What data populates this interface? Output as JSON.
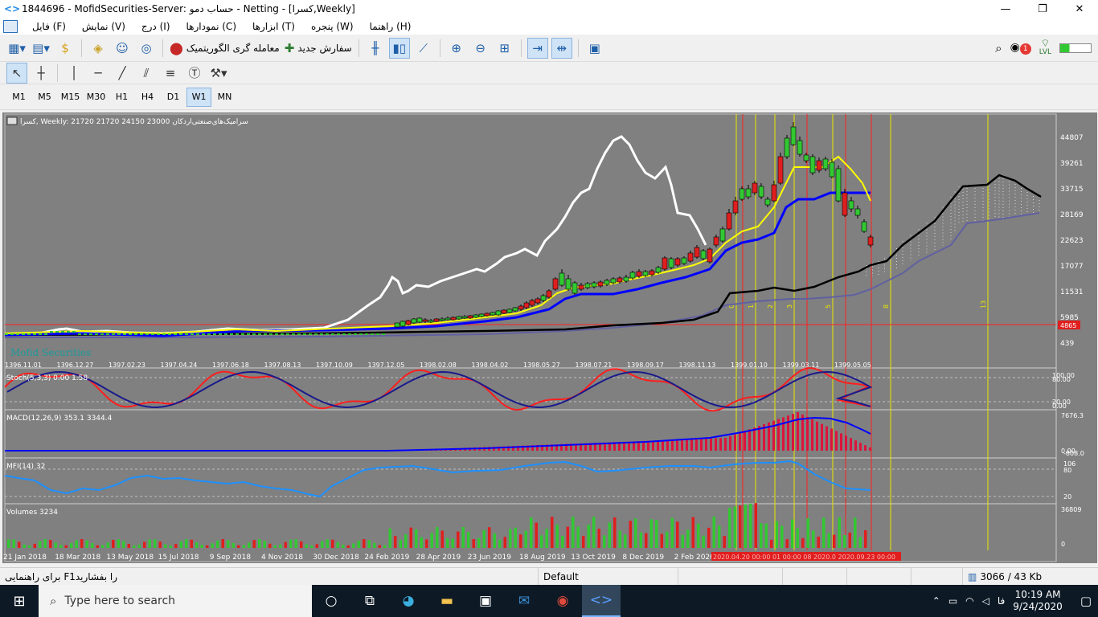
{
  "window": {
    "title": "1844696 - MofidSecurities-Server: حساب دمو - Netting - [کسرا,Weekly]",
    "minimize": "—",
    "maximize": "❐",
    "close": "✕"
  },
  "menu": [
    "فایل (F)",
    "نمایش (V)",
    "درج (I)",
    "نمودارها (C)",
    "ابزارها (T)",
    "پنجره (W)",
    "راهنما (H)"
  ],
  "toolbar": {
    "algo_trading": "معامله گری الگوریتمیک",
    "new_order": "سفارش جدید",
    "notification_count": "1",
    "level_label": "LVL"
  },
  "timeframes": [
    "M1",
    "M5",
    "M15",
    "M30",
    "H1",
    "H4",
    "D1",
    "W1",
    "MN"
  ],
  "active_timeframe": "W1",
  "chart": {
    "header": "کسرا, Weekly:  21720 21720 24150 23000  سرامیک‌های‌صنعتی‌اردکان",
    "watermark": "Mofid Securities",
    "current_price_label": "4865",
    "price_levels": [
      "44807",
      "39261",
      "33715",
      "28169",
      "22623",
      "17077",
      "11531",
      "5985",
      "439"
    ],
    "top_dates": [
      "1396.11.01",
      "1396.12.27",
      "1397.02.23",
      "1397.04.24",
      "1397.06.18",
      "1397.08.13",
      "1397.10.09",
      "1397.12.05",
      "1398.02.08",
      "1398.04.02",
      "1398.05.27",
      "1398.07.21",
      "1398.09.17",
      "1398.11.13",
      "1399.01.10",
      "1399.03.11",
      "1399.05.05"
    ],
    "bottom_dates": [
      "21 Jan 2018",
      "18 Mar 2018",
      "13 May 2018",
      "15 Jul 2018",
      "9 Sep 2018",
      "4 Nov 2018",
      "30 Dec 2018",
      "24 Feb 2019",
      "28 Apr 2019",
      "23 Jun 2019",
      "18 Aug 2019",
      "13 Oct 2019",
      "8 Dec 2019",
      "2 Feb 2020"
    ],
    "highlighted_dates": "2020.04.20 00:00 01 00:00 08 2020.0 2020.09.23 00:00",
    "fib_labels": [
      "0",
      "1",
      "2",
      "3",
      "5",
      "8",
      "13"
    ],
    "stoch": {
      "label": "Stoch(5,3,3) 0.00 1.58",
      "levels": [
        "100.00",
        "80.00",
        "20.00",
        "0.00"
      ]
    },
    "macd": {
      "label": "MACD(12,26,9) 353.1 3344.4",
      "levels": [
        "7676.3",
        "0.00",
        "-808.0"
      ]
    },
    "mfi": {
      "label": "MFI(14) 32",
      "levels": [
        "106",
        "80",
        "20"
      ]
    },
    "volumes": {
      "label": "Volumes 3234",
      "levels": [
        "36809",
        "0"
      ]
    }
  },
  "status": {
    "help": "برای راهنمایی F1را بفشارید",
    "profile": "Default",
    "traffic": "3066 / 43 Kb"
  },
  "taskbar": {
    "search_placeholder": "Type here to search",
    "lang": "فا",
    "time": "10:19 AM",
    "date": "9/24/2020"
  },
  "colors": {
    "chart_bg": "#808080",
    "bull_candle": "#32c832",
    "bear_candle": "#e01e1e",
    "ma_yellow": "#ffff00",
    "ma_blue": "#0000ff",
    "fib_yellow": "#e8e800",
    "fib_red": "#ff2020"
  }
}
